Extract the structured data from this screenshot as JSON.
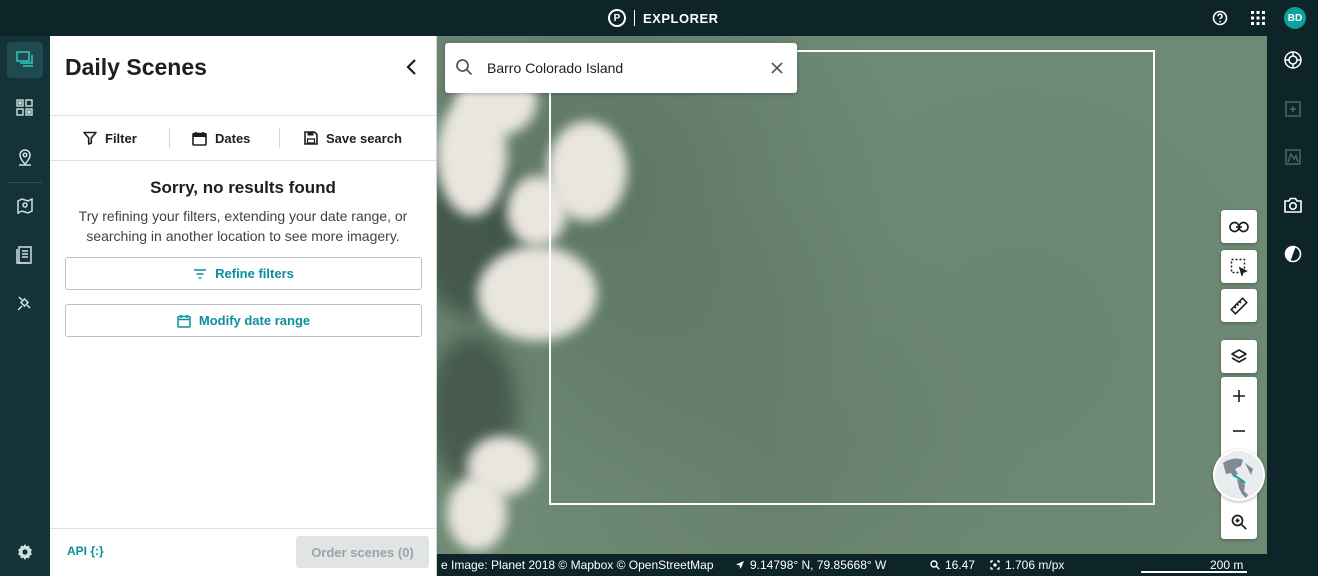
{
  "app": {
    "title": "EXPLORER",
    "logo_letter": "P",
    "user_initials": "BD"
  },
  "panel": {
    "title": "Daily Scenes",
    "toolbar": {
      "filter": "Filter",
      "dates": "Dates",
      "save_search": "Save search"
    },
    "empty_state": {
      "title": "Sorry, no results found",
      "message": "Try refining your filters, extending your date range, or searching in another location to see more imagery.",
      "refine_filters": "Refine filters",
      "modify_date_range": "Modify date range"
    },
    "footer": {
      "api_link": "API {:}",
      "order_button": "Order scenes (0)"
    }
  },
  "map": {
    "search": {
      "value": "Barro Colorado Island"
    },
    "status": {
      "attribution": "e Image: Planet 2018 © Mapbox © OpenStreetMap",
      "coordinates": "9.14798° N, 79.85668° W",
      "zoom": "16.47",
      "resolution": "1.706 m/px",
      "scale": "200 m"
    }
  },
  "colors": {
    "accent": "#0b8f9a",
    "topbar": "#0d2429",
    "leftrail": "#143338"
  }
}
